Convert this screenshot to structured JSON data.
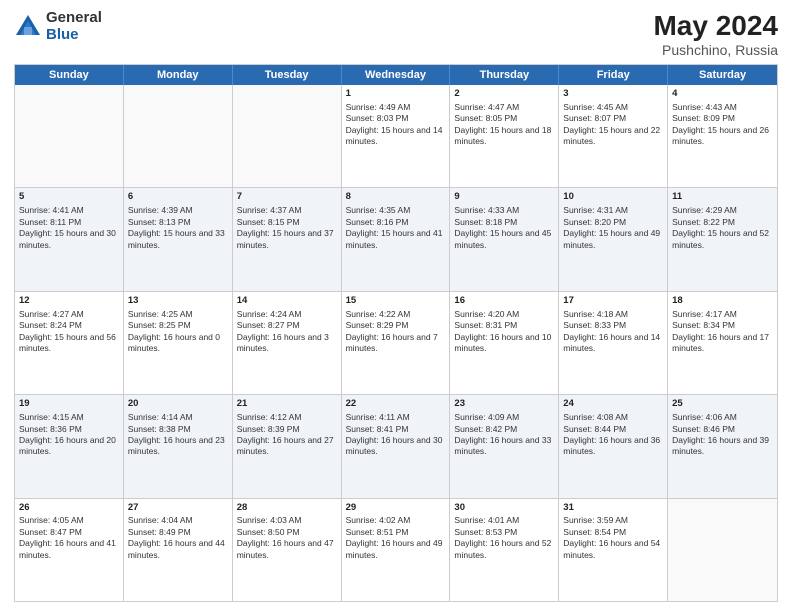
{
  "header": {
    "logo_general": "General",
    "logo_blue": "Blue",
    "title": "May 2024",
    "location": "Pushchino, Russia"
  },
  "weekdays": [
    "Sunday",
    "Monday",
    "Tuesday",
    "Wednesday",
    "Thursday",
    "Friday",
    "Saturday"
  ],
  "rows": [
    [
      {
        "day": "",
        "sunrise": "",
        "sunset": "",
        "daylight": ""
      },
      {
        "day": "",
        "sunrise": "",
        "sunset": "",
        "daylight": ""
      },
      {
        "day": "",
        "sunrise": "",
        "sunset": "",
        "daylight": ""
      },
      {
        "day": "1",
        "sunrise": "Sunrise: 4:49 AM",
        "sunset": "Sunset: 8:03 PM",
        "daylight": "Daylight: 15 hours and 14 minutes."
      },
      {
        "day": "2",
        "sunrise": "Sunrise: 4:47 AM",
        "sunset": "Sunset: 8:05 PM",
        "daylight": "Daylight: 15 hours and 18 minutes."
      },
      {
        "day": "3",
        "sunrise": "Sunrise: 4:45 AM",
        "sunset": "Sunset: 8:07 PM",
        "daylight": "Daylight: 15 hours and 22 minutes."
      },
      {
        "day": "4",
        "sunrise": "Sunrise: 4:43 AM",
        "sunset": "Sunset: 8:09 PM",
        "daylight": "Daylight: 15 hours and 26 minutes."
      }
    ],
    [
      {
        "day": "5",
        "sunrise": "Sunrise: 4:41 AM",
        "sunset": "Sunset: 8:11 PM",
        "daylight": "Daylight: 15 hours and 30 minutes."
      },
      {
        "day": "6",
        "sunrise": "Sunrise: 4:39 AM",
        "sunset": "Sunset: 8:13 PM",
        "daylight": "Daylight: 15 hours and 33 minutes."
      },
      {
        "day": "7",
        "sunrise": "Sunrise: 4:37 AM",
        "sunset": "Sunset: 8:15 PM",
        "daylight": "Daylight: 15 hours and 37 minutes."
      },
      {
        "day": "8",
        "sunrise": "Sunrise: 4:35 AM",
        "sunset": "Sunset: 8:16 PM",
        "daylight": "Daylight: 15 hours and 41 minutes."
      },
      {
        "day": "9",
        "sunrise": "Sunrise: 4:33 AM",
        "sunset": "Sunset: 8:18 PM",
        "daylight": "Daylight: 15 hours and 45 minutes."
      },
      {
        "day": "10",
        "sunrise": "Sunrise: 4:31 AM",
        "sunset": "Sunset: 8:20 PM",
        "daylight": "Daylight: 15 hours and 49 minutes."
      },
      {
        "day": "11",
        "sunrise": "Sunrise: 4:29 AM",
        "sunset": "Sunset: 8:22 PM",
        "daylight": "Daylight: 15 hours and 52 minutes."
      }
    ],
    [
      {
        "day": "12",
        "sunrise": "Sunrise: 4:27 AM",
        "sunset": "Sunset: 8:24 PM",
        "daylight": "Daylight: 15 hours and 56 minutes."
      },
      {
        "day": "13",
        "sunrise": "Sunrise: 4:25 AM",
        "sunset": "Sunset: 8:25 PM",
        "daylight": "Daylight: 16 hours and 0 minutes."
      },
      {
        "day": "14",
        "sunrise": "Sunrise: 4:24 AM",
        "sunset": "Sunset: 8:27 PM",
        "daylight": "Daylight: 16 hours and 3 minutes."
      },
      {
        "day": "15",
        "sunrise": "Sunrise: 4:22 AM",
        "sunset": "Sunset: 8:29 PM",
        "daylight": "Daylight: 16 hours and 7 minutes."
      },
      {
        "day": "16",
        "sunrise": "Sunrise: 4:20 AM",
        "sunset": "Sunset: 8:31 PM",
        "daylight": "Daylight: 16 hours and 10 minutes."
      },
      {
        "day": "17",
        "sunrise": "Sunrise: 4:18 AM",
        "sunset": "Sunset: 8:33 PM",
        "daylight": "Daylight: 16 hours and 14 minutes."
      },
      {
        "day": "18",
        "sunrise": "Sunrise: 4:17 AM",
        "sunset": "Sunset: 8:34 PM",
        "daylight": "Daylight: 16 hours and 17 minutes."
      }
    ],
    [
      {
        "day": "19",
        "sunrise": "Sunrise: 4:15 AM",
        "sunset": "Sunset: 8:36 PM",
        "daylight": "Daylight: 16 hours and 20 minutes."
      },
      {
        "day": "20",
        "sunrise": "Sunrise: 4:14 AM",
        "sunset": "Sunset: 8:38 PM",
        "daylight": "Daylight: 16 hours and 23 minutes."
      },
      {
        "day": "21",
        "sunrise": "Sunrise: 4:12 AM",
        "sunset": "Sunset: 8:39 PM",
        "daylight": "Daylight: 16 hours and 27 minutes."
      },
      {
        "day": "22",
        "sunrise": "Sunrise: 4:11 AM",
        "sunset": "Sunset: 8:41 PM",
        "daylight": "Daylight: 16 hours and 30 minutes."
      },
      {
        "day": "23",
        "sunrise": "Sunrise: 4:09 AM",
        "sunset": "Sunset: 8:42 PM",
        "daylight": "Daylight: 16 hours and 33 minutes."
      },
      {
        "day": "24",
        "sunrise": "Sunrise: 4:08 AM",
        "sunset": "Sunset: 8:44 PM",
        "daylight": "Daylight: 16 hours and 36 minutes."
      },
      {
        "day": "25",
        "sunrise": "Sunrise: 4:06 AM",
        "sunset": "Sunset: 8:46 PM",
        "daylight": "Daylight: 16 hours and 39 minutes."
      }
    ],
    [
      {
        "day": "26",
        "sunrise": "Sunrise: 4:05 AM",
        "sunset": "Sunset: 8:47 PM",
        "daylight": "Daylight: 16 hours and 41 minutes."
      },
      {
        "day": "27",
        "sunrise": "Sunrise: 4:04 AM",
        "sunset": "Sunset: 8:49 PM",
        "daylight": "Daylight: 16 hours and 44 minutes."
      },
      {
        "day": "28",
        "sunrise": "Sunrise: 4:03 AM",
        "sunset": "Sunset: 8:50 PM",
        "daylight": "Daylight: 16 hours and 47 minutes."
      },
      {
        "day": "29",
        "sunrise": "Sunrise: 4:02 AM",
        "sunset": "Sunset: 8:51 PM",
        "daylight": "Daylight: 16 hours and 49 minutes."
      },
      {
        "day": "30",
        "sunrise": "Sunrise: 4:01 AM",
        "sunset": "Sunset: 8:53 PM",
        "daylight": "Daylight: 16 hours and 52 minutes."
      },
      {
        "day": "31",
        "sunrise": "Sunrise: 3:59 AM",
        "sunset": "Sunset: 8:54 PM",
        "daylight": "Daylight: 16 hours and 54 minutes."
      },
      {
        "day": "",
        "sunrise": "",
        "sunset": "",
        "daylight": ""
      }
    ]
  ]
}
